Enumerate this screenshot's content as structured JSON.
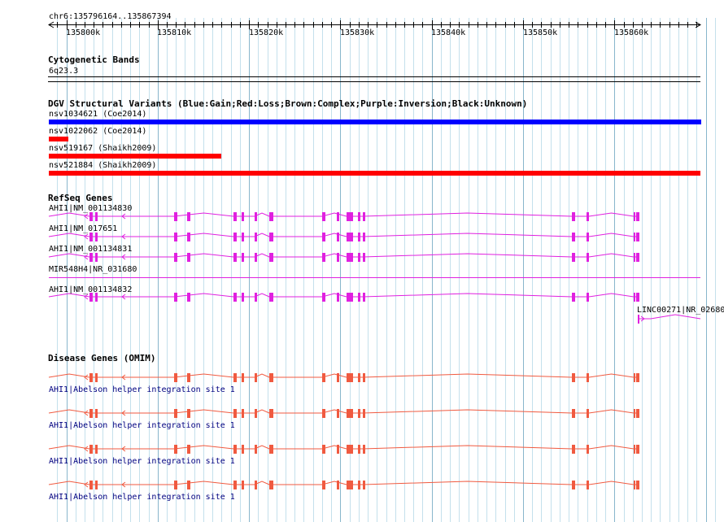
{
  "ruler": {
    "location": "chr6:135796164..135867394",
    "ticks": [
      "135800k",
      "135810k",
      "135820k",
      "135830k",
      "135840k",
      "135850k",
      "135860k"
    ]
  },
  "tracks": {
    "cytobands": {
      "title": "Cytogenetic Bands",
      "band": "6q23.3"
    },
    "dgv": {
      "title": "DGV Structural Variants (Blue:Gain;Red:Loss;Brown:Complex;Purple:Inversion;Black:Unknown)",
      "colors": {
        "gain": "#0000ff",
        "loss": "#ff0000"
      },
      "items": [
        {
          "label": "nsv1034621 (Coe2014)",
          "type": "gain"
        },
        {
          "label": "nsv1022062 (Coe2014)",
          "type": "loss"
        },
        {
          "label": "nsv519167 (Shaikh2009)",
          "type": "loss"
        },
        {
          "label": "nsv521884 (Shaikh2009)",
          "type": "loss"
        }
      ]
    },
    "refseq": {
      "title": "RefSeq Genes",
      "color": "#e020e0",
      "genes": [
        {
          "label": "AHI1|NM_001134830"
        },
        {
          "label": "AHI1|NM_017651"
        },
        {
          "label": "AHI1|NM_001134831"
        },
        {
          "label": "MIR548H4|NR_031680"
        },
        {
          "label": "AHI1|NM_001134832"
        },
        {
          "label": "LINC00271|NR_02680"
        }
      ]
    },
    "omim": {
      "title": "Disease Genes (OMIM)",
      "color": "#f05a40",
      "genes": [
        {
          "label": "AHI1|Abelson helper integration site 1"
        },
        {
          "label": "AHI1|Abelson helper integration site 1"
        },
        {
          "label": "AHI1|Abelson helper integration site 1"
        },
        {
          "label": "AHI1|Abelson helper integration site 1"
        }
      ]
    }
  }
}
